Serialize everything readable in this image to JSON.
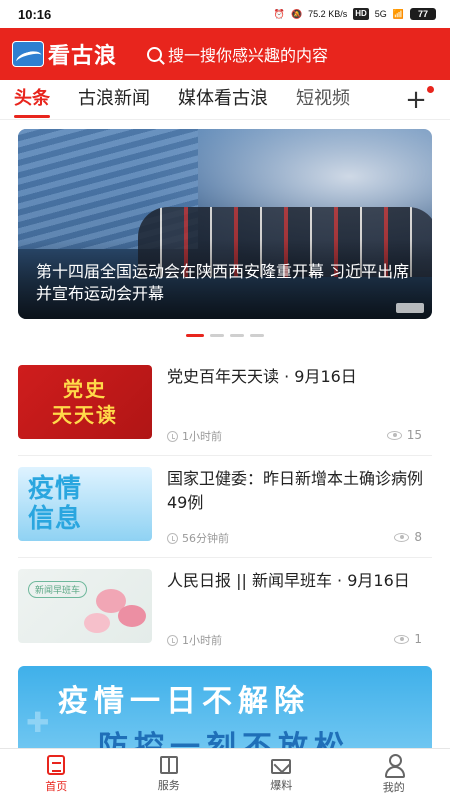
{
  "status_bar": {
    "time": "10:16",
    "net_speed": "75.2 KB/s",
    "hd_label": "HD",
    "signal_label": "5G",
    "battery": "77"
  },
  "app": {
    "name": "看古浪",
    "search_placeholder": "搜一搜你感兴趣的内容",
    "colors": {
      "brand": "#e8251d"
    }
  },
  "tabs": [
    {
      "label": "头条",
      "active": true
    },
    {
      "label": "古浪新闻",
      "active": false
    },
    {
      "label": "媒体看古浪",
      "active": false
    },
    {
      "label": "短视频",
      "active": false
    }
  ],
  "add_tab_icon": "plus-icon",
  "hero": {
    "title": "第十四届全国运动会在陕西西安隆重开幕 习近平出席并宣布运动会开幕",
    "carousel_count": 4,
    "carousel_active": 0
  },
  "news": [
    {
      "title": "党史百年天天读 · 9月16日",
      "time": "1小时前",
      "views": "15",
      "thumb_lines": [
        "党史",
        "天天读"
      ]
    },
    {
      "title": "国家卫健委：昨日新增本土确诊病例49例",
      "time": "56分钟前",
      "views": "8",
      "thumb_lines": [
        "疫情",
        "信息"
      ]
    },
    {
      "title": "人民日报 || 新闻早班车 · 9月16日",
      "time": "1小时前",
      "views": "1",
      "thumb_tag": "新闻早班车"
    }
  ],
  "banner": {
    "line1": "疫情一日不解除",
    "line2": "防控一刻不放松"
  },
  "bottom_nav": [
    {
      "label": "首页",
      "icon": "home-icon",
      "active": true
    },
    {
      "label": "服务",
      "icon": "service-icon",
      "active": false
    },
    {
      "label": "爆料",
      "icon": "mail-icon",
      "active": false
    },
    {
      "label": "我的",
      "icon": "user-icon",
      "active": false
    }
  ]
}
